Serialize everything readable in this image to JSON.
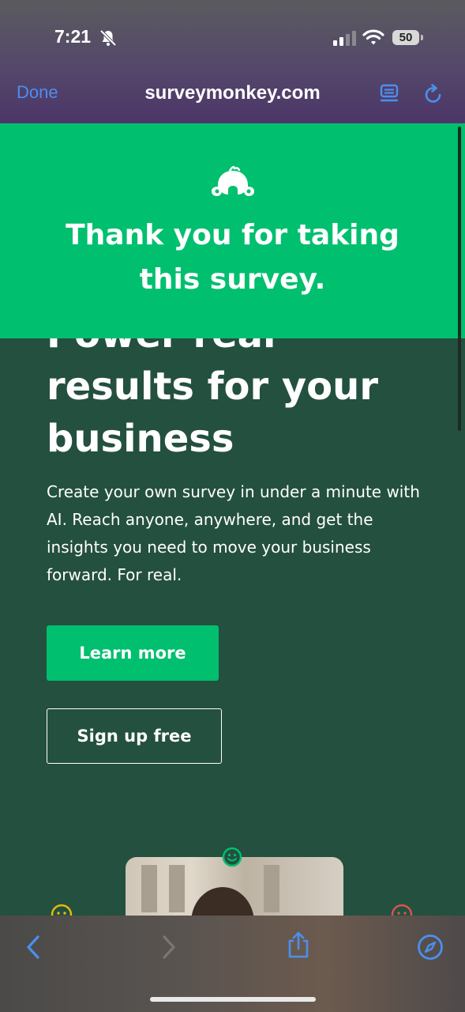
{
  "status_bar": {
    "time": "7:21",
    "battery": "50",
    "icons": [
      "bell-slash-icon",
      "signal-icon",
      "wifi-icon",
      "battery-icon"
    ]
  },
  "browser_nav": {
    "done_label": "Done",
    "url": "surveymonkey.com",
    "icons": [
      "reader-icon",
      "reload-icon"
    ],
    "accent_color": "#4b8ff0"
  },
  "banner": {
    "logo_icon": "surveymonkey-logo-icon",
    "message": "Thank you for taking this survey.",
    "color": "#00bf6f"
  },
  "hero": {
    "title": "Power real\nresults for your\nbusiness",
    "description": "Create your own survey in under a minute with AI. Reach anyone, anywhere, and get the insights you need to move your business forward. For real.",
    "learn_more_label": "Learn more",
    "signup_label": "Sign up free",
    "background_color": "#24503f"
  },
  "bottom_toolbar": {
    "icons": [
      "back-icon",
      "forward-icon",
      "share-icon",
      "compass-icon"
    ]
  }
}
